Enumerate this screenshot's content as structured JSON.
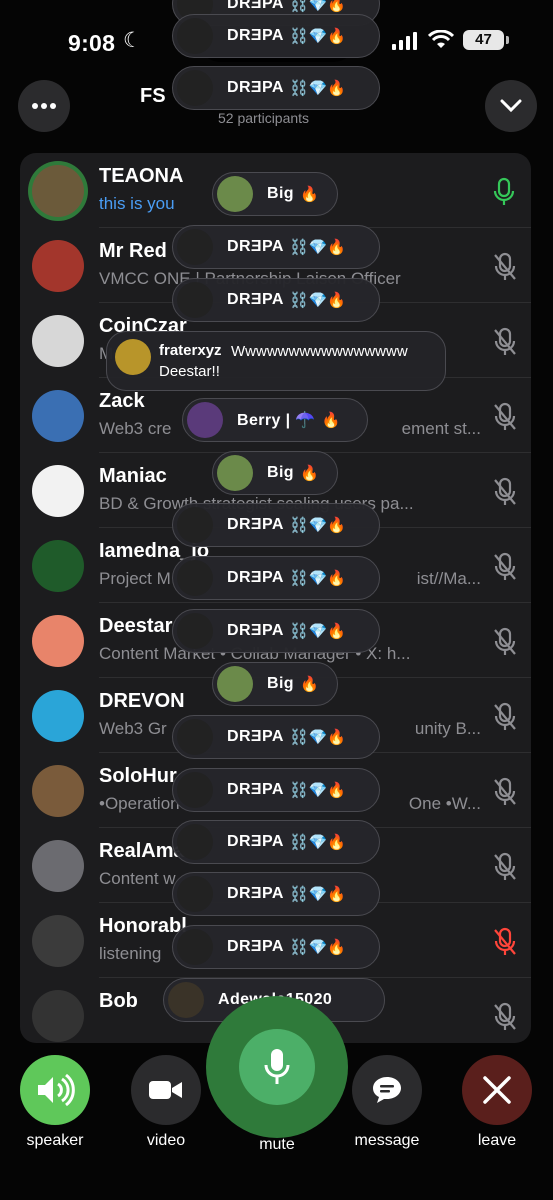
{
  "status": {
    "time": "9:08",
    "battery": "47"
  },
  "header": {
    "title": "FS",
    "participants": "52 participants"
  },
  "colors": {
    "speaker_green": "#5fc85a",
    "leave_red": "#5a1f1c",
    "mute_green": "#2f7a3a",
    "you_blue": "#4a9df5",
    "mic_active": "#35c759",
    "mic_muted_red": "#ff453a"
  },
  "participants": [
    {
      "name": "TEAONA",
      "sub": "this is you",
      "mic": "active",
      "avatar": "#6b5a3a"
    },
    {
      "name": "Mr Red",
      "sub": "VMCC ONE | Partnership Laison Officer",
      "mic": "muted",
      "avatar": "#a3362c"
    },
    {
      "name": "CoinCzar",
      "sub": "M",
      "mic": "muted",
      "avatar": "#d7d7d7"
    },
    {
      "name": "Zack",
      "sub": "Web3 cre",
      "sub2": "ement st...",
      "mic": "muted",
      "avatar": "#3a6fb3"
    },
    {
      "name": "Maniac",
      "sub": "BD & Growth strategist scaling users pa...",
      "mic": "muted",
      "avatar": "#f2f2f2"
    },
    {
      "name": "Iamedna_jo",
      "sub": "Project M",
      "sub2": "ist//Ma...",
      "mic": "muted",
      "avatar": "#1f5b2a"
    },
    {
      "name": "Deestar",
      "sub": "Content Market • Collab Manager • X: h...",
      "mic": "muted",
      "avatar": "#e8846a"
    },
    {
      "name": "DREVON",
      "sub": "Web3 Gr",
      "sub2": "unity B...",
      "mic": "muted",
      "avatar": "#2aa5d8"
    },
    {
      "name": "SoloHur",
      "sub": "•Operation",
      "sub2": "One •W...",
      "mic": "muted",
      "avatar": "#7a5b3b"
    },
    {
      "name": "RealAma",
      "sub": "Content w",
      "mic": "muted",
      "avatar": "#6b6b70"
    },
    {
      "name": "Honorabl",
      "sub": "listening",
      "mic": "muted-red",
      "avatar": "#3b3b3b"
    },
    {
      "name": "Bob",
      "sub": "",
      "mic": "muted",
      "avatar": "#333333"
    }
  ],
  "reactions": [
    {
      "name": "DRƎPA",
      "emoji": "⛓️💎🔥",
      "av": "#222"
    },
    {
      "name": "DRƎPA",
      "emoji": "⛓️💎🔥",
      "av": "#222"
    },
    {
      "name": "DRƎPA",
      "emoji": "⛓️💎🔥",
      "av": "#222"
    },
    {
      "name": "Big",
      "emoji": "🔥",
      "av": "#6b8a4a"
    },
    {
      "name": "DRƎPA",
      "emoji": "⛓️💎🔥",
      "av": "#222"
    },
    {
      "name": "DRƎPA",
      "emoji": "⛓️💎🔥",
      "av": "#222"
    },
    {
      "name": "Berry | ☂️",
      "emoji": "🔥",
      "av": "#5a3a7a"
    },
    {
      "name": "Big",
      "emoji": "🔥",
      "av": "#6b8a4a"
    },
    {
      "name": "DRƎPA",
      "emoji": "⛓️💎🔥",
      "av": "#222"
    },
    {
      "name": "DRƎPA",
      "emoji": "⛓️💎🔥",
      "av": "#222"
    },
    {
      "name": "DRƎPA",
      "emoji": "⛓️💎🔥",
      "av": "#222"
    },
    {
      "name": "Big",
      "emoji": "🔥",
      "av": "#6b8a4a"
    },
    {
      "name": "DRƎPA",
      "emoji": "⛓️💎🔥",
      "av": "#222"
    },
    {
      "name": "DRƎPA",
      "emoji": "⛓️💎🔥",
      "av": "#222"
    },
    {
      "name": "DRƎPA",
      "emoji": "⛓️💎🔥",
      "av": "#222"
    },
    {
      "name": "DRƎPA",
      "emoji": "⛓️💎🔥",
      "av": "#222"
    },
    {
      "name": "DRƎPA",
      "emoji": "⛓️💎🔥",
      "av": "#222"
    },
    {
      "name": "Adewale15020",
      "emoji": "",
      "av": "#3a3328"
    }
  ],
  "chat_bubble": {
    "name": "fraterxyz",
    "message": "Wwwwwwwwwwwwwwww Deestar!!"
  },
  "controls": {
    "speaker": "speaker",
    "video": "video",
    "mute": "mute",
    "message": "message",
    "leave": "leave"
  }
}
